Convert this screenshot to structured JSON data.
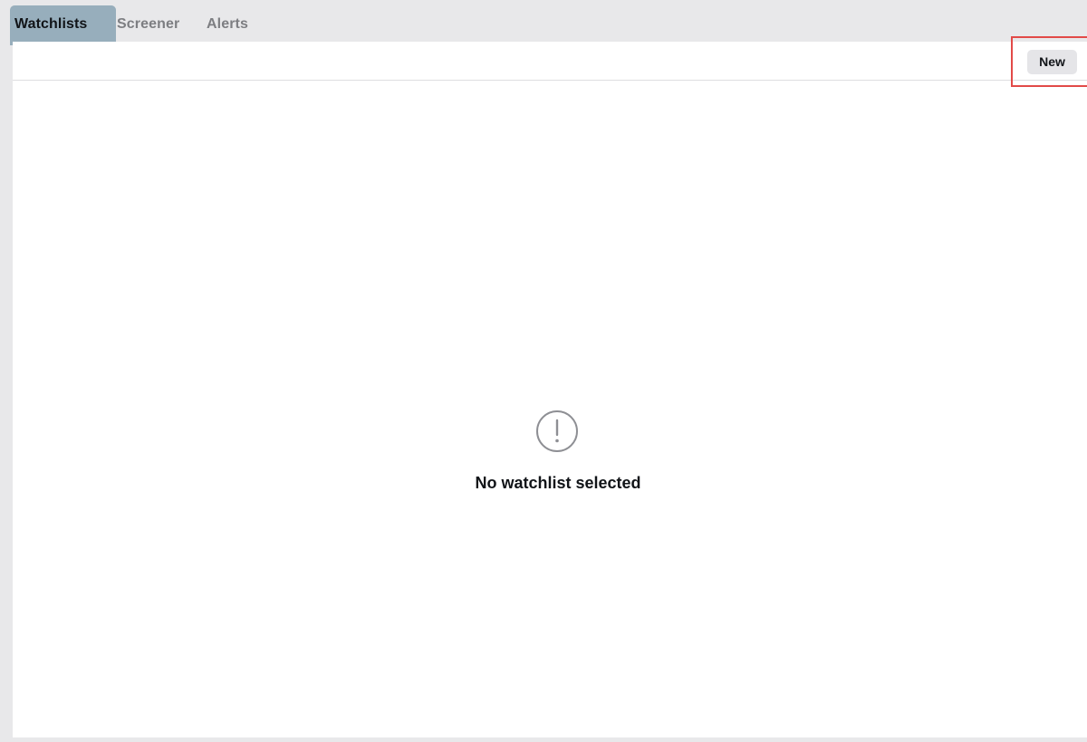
{
  "tabs": [
    {
      "label": "Watchlists",
      "active": true
    },
    {
      "label": "Screener",
      "active": false
    },
    {
      "label": "Alerts",
      "active": false
    }
  ],
  "toolbar": {
    "new_label": "New"
  },
  "empty_state": {
    "icon": "exclamation-circle-icon",
    "message": "No watchlist selected"
  },
  "colors": {
    "active_tab": "#97aebc",
    "highlight_box": "#e24a48",
    "frame": "#e8e8ea"
  }
}
